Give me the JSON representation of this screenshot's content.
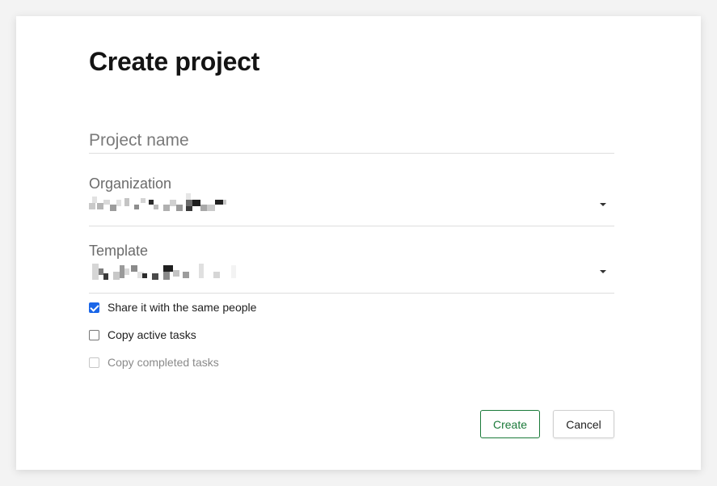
{
  "dialog": {
    "title": "Create project"
  },
  "project_name": {
    "placeholder": "Project name",
    "value": ""
  },
  "organization": {
    "label": "Organization",
    "value_redacted": true
  },
  "template": {
    "label": "Template",
    "value_redacted": true
  },
  "options": [
    {
      "label": "Share it with the same people",
      "checked": true,
      "disabled": false
    },
    {
      "label": "Copy active tasks",
      "checked": false,
      "disabled": false
    },
    {
      "label": "Copy completed tasks",
      "checked": false,
      "disabled": true
    }
  ],
  "actions": {
    "create_label": "Create",
    "cancel_label": "Cancel"
  },
  "colors": {
    "primary": "#1b7a3a",
    "checkbox_accent": "#1a66e8"
  }
}
